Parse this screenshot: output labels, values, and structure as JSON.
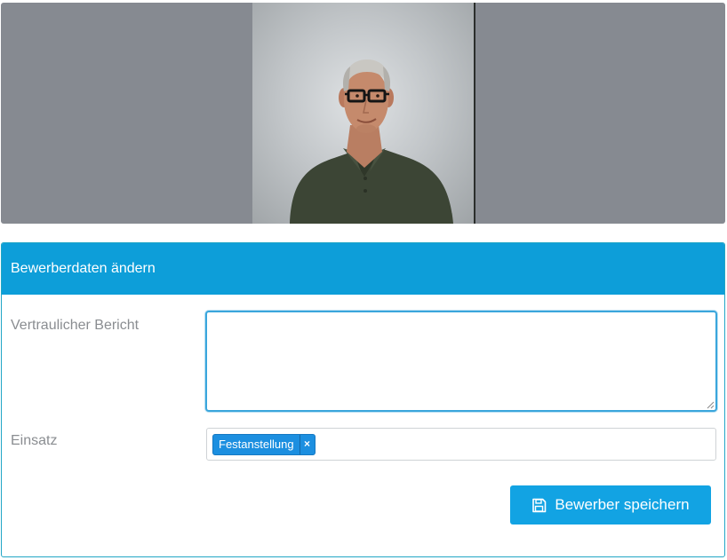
{
  "applicant_photo": {
    "icon": "applicant-portrait-photo"
  },
  "panel": {
    "title": "Bewerberdaten ändern"
  },
  "form": {
    "confidential_report": {
      "label": "Vertraulicher Bericht",
      "value": "",
      "placeholder": ""
    },
    "assignment": {
      "label": "Einsatz",
      "tags": [
        {
          "label": "Festanstellung",
          "remove_label": "×"
        }
      ]
    },
    "save_button": {
      "label": "Bewerber speichern",
      "icon": "save-floppy-icon"
    }
  },
  "colors": {
    "accent": "#0d9ed9",
    "button": "#12a3e3",
    "tag": "#1c8fe0",
    "photo_backdrop": "#868a91"
  }
}
